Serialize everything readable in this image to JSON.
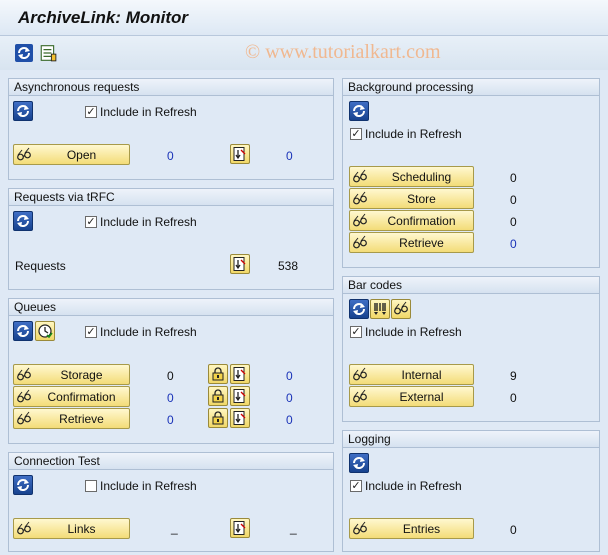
{
  "window": {
    "title": "ArchiveLink: Monitor",
    "watermark": "© www.tutorialkart.com"
  },
  "toolbar": {
    "icons": [
      "refresh-icon",
      "display-list-icon"
    ]
  },
  "asynchronous": {
    "title": "Asynchronous requests",
    "include_label": "Include in Refresh",
    "include_checked": true,
    "open_label": "Open",
    "open_value": "0",
    "error_value": "0"
  },
  "tRFC": {
    "title": "Requests via tRFC",
    "include_label": "Include in Refresh",
    "include_checked": true,
    "requests_label": "Requests",
    "requests_value": "538"
  },
  "queues": {
    "title": "Queues",
    "include_label": "Include in Refresh",
    "include_checked": true,
    "rows": [
      {
        "label": "Storage",
        "value": "0",
        "error": "0"
      },
      {
        "label": "Confirmation",
        "value": "0",
        "error": "0"
      },
      {
        "label": "Retrieve",
        "value": "0",
        "error": "0"
      }
    ]
  },
  "connection": {
    "title": "Connection Test",
    "include_label": "Include in Refresh",
    "include_checked": false,
    "links_label": "Links",
    "links_value": "_",
    "error_value": "_"
  },
  "background": {
    "title": "Background processing",
    "include_label": "Include in Refresh",
    "include_checked": true,
    "rows": [
      {
        "label": "Scheduling",
        "value": "0"
      },
      {
        "label": "Store",
        "value": "0"
      },
      {
        "label": "Confirmation",
        "value": "0"
      },
      {
        "label": "Retrieve",
        "value": "0"
      }
    ]
  },
  "barcodes": {
    "title": "Bar codes",
    "include_label": "Include in Refresh",
    "include_checked": true,
    "rows": [
      {
        "label": "Internal",
        "value": "9"
      },
      {
        "label": "External",
        "value": "0"
      }
    ]
  },
  "logging": {
    "title": "Logging",
    "include_label": "Include in Refresh",
    "include_checked": true,
    "entries_label": "Entries",
    "entries_value": "0"
  },
  "colors": {
    "value_blue": "#1a33b8",
    "button_yellow": "#f3dc78",
    "section_bg": "#dfe9f5"
  }
}
